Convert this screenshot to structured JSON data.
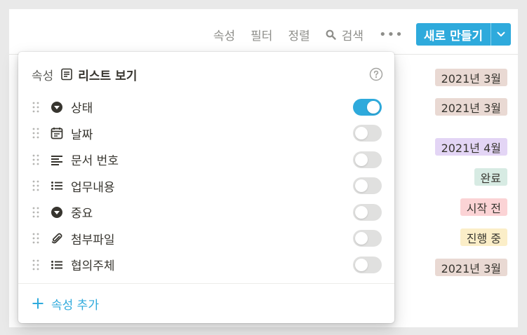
{
  "toolbar": {
    "properties": "속성",
    "filter": "필터",
    "sort": "정렬",
    "search": "검색",
    "more": "•••",
    "new_button": "새로 만들기"
  },
  "tags": [
    {
      "text": "2021년 3월",
      "bg": "#e9d9d3"
    },
    {
      "text": "2021년 3월",
      "bg": "#e9d9d3"
    },
    {
      "text": "2021년 4월",
      "bg": "#e3d5f5"
    },
    {
      "text": "완료",
      "bg": "#d7ebe3"
    },
    {
      "text": "시작 전",
      "bg": "#fbd3d5"
    },
    {
      "text": "진행 중",
      "bg": "#fbeec8"
    },
    {
      "text": "2021년 3월",
      "bg": "#e9d9d3"
    }
  ],
  "panel": {
    "header_label": "속성",
    "view_name": "리스트 보기",
    "view_icon": "list-view-icon",
    "help_icon": "help-circle-icon",
    "properties": [
      {
        "name": "상태",
        "icon": "select-icon",
        "visible": true
      },
      {
        "name": "날짜",
        "icon": "calendar-icon",
        "visible": false
      },
      {
        "name": "문서 번호",
        "icon": "text-icon",
        "visible": false
      },
      {
        "name": "업무내용",
        "icon": "multi-select-icon",
        "visible": false
      },
      {
        "name": "중요",
        "icon": "select-icon",
        "visible": false
      },
      {
        "name": "첨부파일",
        "icon": "paperclip-icon",
        "visible": false
      },
      {
        "name": "협의주체",
        "icon": "multi-select-icon",
        "visible": false
      }
    ],
    "add_property": "속성 추가"
  },
  "colors": {
    "accent": "#2eaadc",
    "text": "#37352f",
    "muted": "#8e8e8a"
  }
}
